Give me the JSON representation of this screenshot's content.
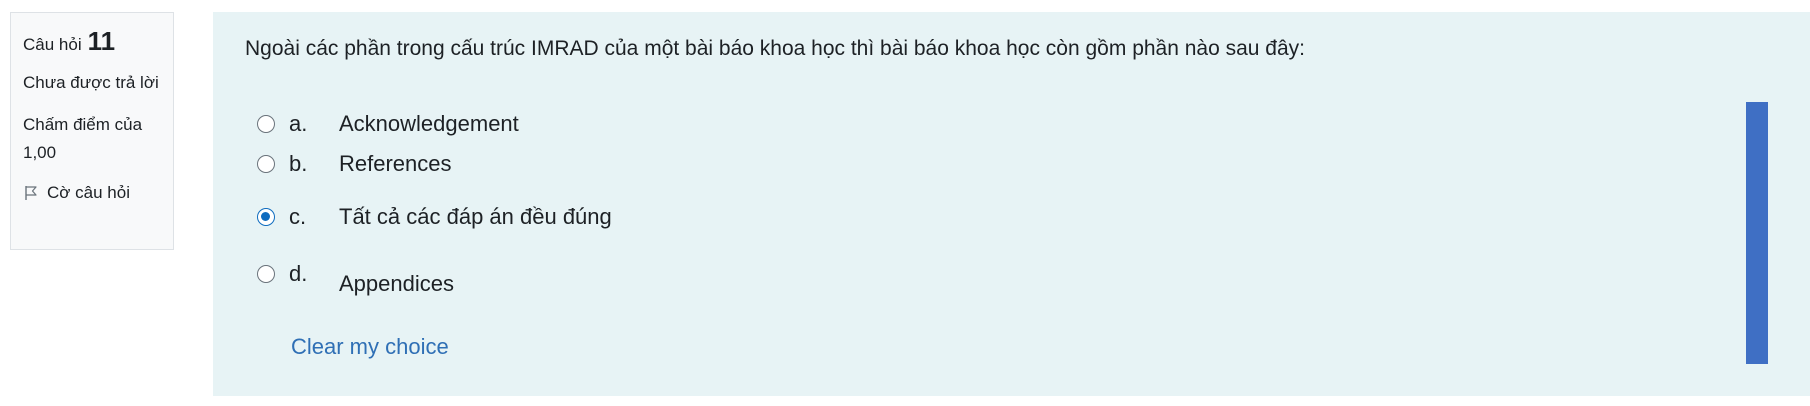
{
  "info": {
    "question_label": "Câu hỏi",
    "question_number": "11",
    "state": "Chưa được trả lời",
    "grade": "Chấm điểm của 1,00",
    "flag_label": "Cờ câu hỏi",
    "flag_icon": "flag-icon"
  },
  "question": {
    "text": "Ngoài các phần trong cấu trúc IMRAD của một bài báo khoa học thì bài báo khoa học còn gồm phần nào sau đây:",
    "options": [
      {
        "letter": "a.",
        "text": "Acknowledgement",
        "selected": false
      },
      {
        "letter": "b.",
        "text": "References",
        "selected": false
      },
      {
        "letter": "c.",
        "text": "Tất cả các đáp án đều đúng",
        "selected": true
      },
      {
        "letter": "d.",
        "text": "Appendices",
        "selected": false
      }
    ],
    "clear_label": "Clear my choice"
  },
  "colors": {
    "content_bg": "#e7f3f5",
    "link": "#2f6fb5",
    "radio_checked": "#0f6cbf",
    "scrollbar": "#3f6fc4"
  }
}
